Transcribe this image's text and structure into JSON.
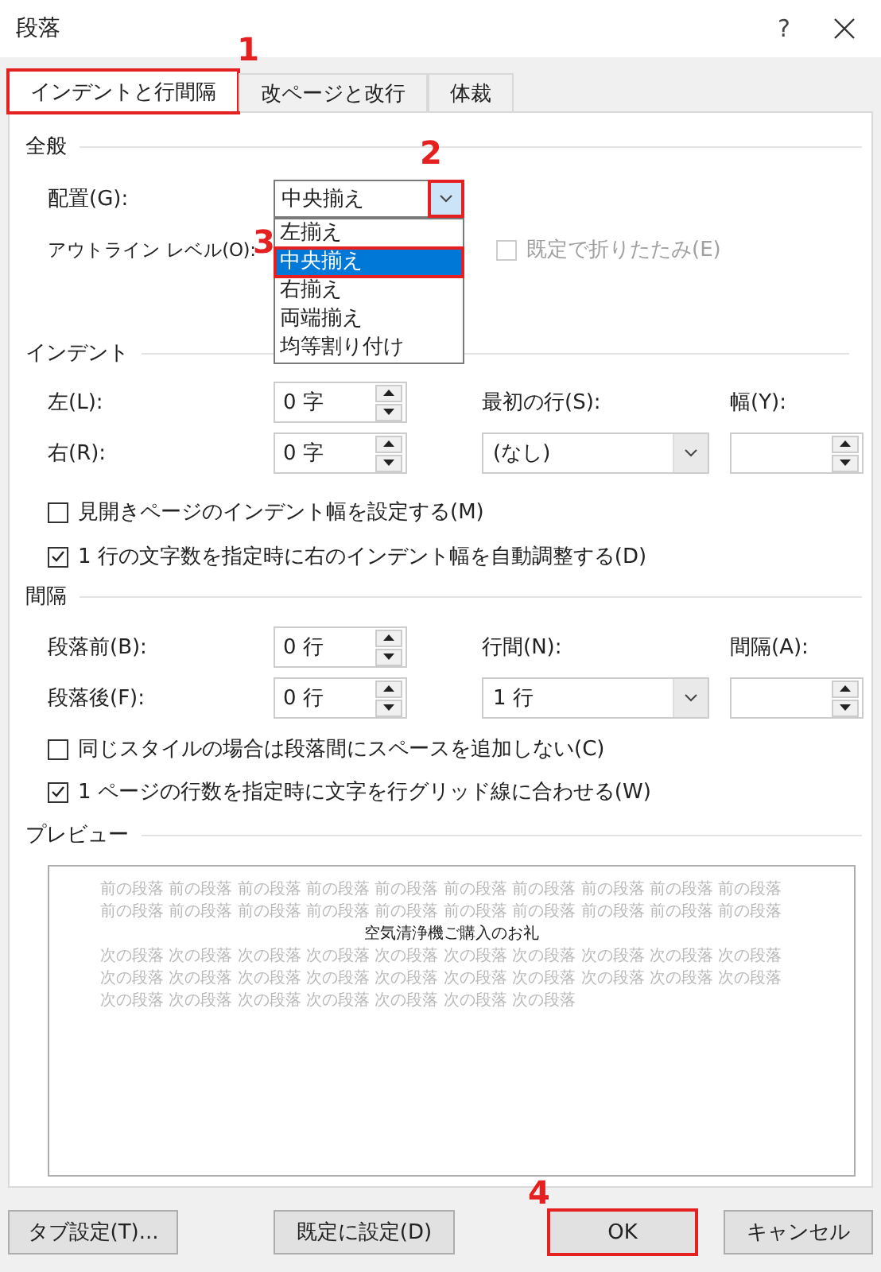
{
  "window": {
    "title": "段落",
    "help": "?"
  },
  "tabs": [
    {
      "label": "インデントと行間隔",
      "selected": true,
      "callout": "1"
    },
    {
      "label": "改ページと改行",
      "selected": false
    },
    {
      "label": "体裁",
      "selected": false
    }
  ],
  "general": {
    "heading": "全般",
    "alignment": {
      "label": "配置(G):",
      "value": "中央揃え",
      "expanded": true,
      "button_callout": "2",
      "options": [
        {
          "label": "左揃え",
          "selected": false
        },
        {
          "label": "中央揃え",
          "selected": true,
          "callout": "3"
        },
        {
          "label": "右揃え",
          "selected": false
        },
        {
          "label": "両端揃え",
          "selected": false
        },
        {
          "label": "均等割り付け",
          "selected": false
        }
      ]
    },
    "outline_label": "アウトライン レベル(O):",
    "collapse": {
      "label": "既定で折りたたみ(E)",
      "checked": false,
      "disabled": true
    }
  },
  "indent": {
    "heading": "インデント",
    "left": {
      "label": "左(L):",
      "value": "0 字"
    },
    "right": {
      "label": "右(R):",
      "value": "0 字"
    },
    "first_line": {
      "label": "最初の行(S):",
      "value": "(なし)"
    },
    "by_label": "幅(Y):",
    "checkboxes": [
      {
        "label": "見開きページのインデント幅を設定する(M)",
        "checked": false
      },
      {
        "label": "1 行の文字数を指定時に右のインデント幅を自動調整する(D)",
        "checked": true
      }
    ]
  },
  "spacing": {
    "heading": "間隔",
    "before": {
      "label": "段落前(B):",
      "value": "0 行"
    },
    "after": {
      "label": "段落後(F):",
      "value": "0 行"
    },
    "line_spacing": {
      "label": "行間(N):",
      "value": "1 行"
    },
    "at_label": "間隔(A):",
    "checkboxes": [
      {
        "label": "同じスタイルの場合は段落間にスペースを追加しない(C)",
        "checked": false
      },
      {
        "label": "1 ページの行数を指定時に文字を行グリッド線に合わせる(W)",
        "checked": true
      }
    ]
  },
  "preview": {
    "heading": "プレビュー",
    "previous_lines": [
      "前の段落 前の段落 前の段落 前の段落 前の段落 前の段落 前の段落 前の段落 前の段落 前の段落",
      "前の段落 前の段落 前の段落 前の段落 前の段落 前の段落 前の段落 前の段落 前の段落 前の段落"
    ],
    "sample": "空気清浄機ご購入のお礼",
    "next_lines": [
      "次の段落 次の段落 次の段落 次の段落 次の段落 次の段落 次の段落 次の段落 次の段落 次の段落",
      "次の段落 次の段落 次の段落 次の段落 次の段落 次の段落 次の段落 次の段落 次の段落 次の段落",
      "次の段落 次の段落 次の段落 次の段落 次の段落 次の段落 次の段落"
    ]
  },
  "buttons": [
    {
      "label": "タブ設定(T)..."
    },
    {
      "label": "既定に設定(D)"
    },
    {
      "label": "OK",
      "callout": "4"
    },
    {
      "label": "キャンセル"
    }
  ]
}
